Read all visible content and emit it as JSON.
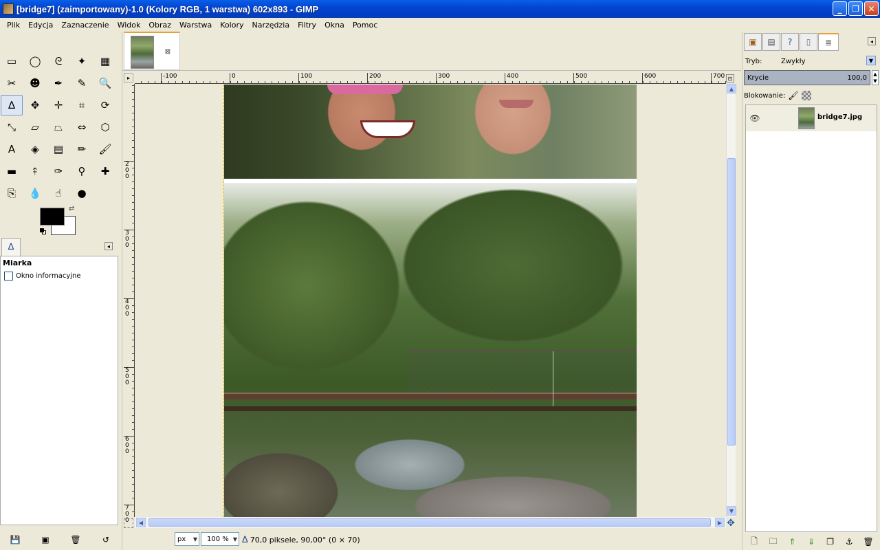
{
  "window": {
    "title": "[bridge7] (zaimportowany)-1.0 (Kolory RGB, 1 warstwa) 602x893 - GIMP",
    "minimize": "_",
    "maximize": "❐",
    "close": "✕"
  },
  "menu": {
    "items": [
      "Plik",
      "Edycja",
      "Zaznaczenie",
      "Widok",
      "Obraz",
      "Warstwa",
      "Kolory",
      "Narzędzia",
      "Filtry",
      "Okna",
      "Pomoc"
    ]
  },
  "toolbox": {
    "tools": [
      {
        "name": "rect-select-icon",
        "glyph": "▭"
      },
      {
        "name": "ellipse-select-icon",
        "glyph": "◯"
      },
      {
        "name": "free-select-icon",
        "glyph": "ᘓ"
      },
      {
        "name": "fuzzy-select-icon",
        "glyph": "✦"
      },
      {
        "name": "select-by-color-icon",
        "glyph": "▦"
      },
      {
        "name": "scissors-icon",
        "glyph": "✂"
      },
      {
        "name": "foreground-select-icon",
        "glyph": "☻"
      },
      {
        "name": "paths-icon",
        "glyph": "✒"
      },
      {
        "name": "color-picker-icon",
        "glyph": "✎"
      },
      {
        "name": "zoom-icon",
        "glyph": "🔍"
      },
      {
        "name": "measure-icon",
        "glyph": "∆"
      },
      {
        "name": "move-icon",
        "glyph": "✥"
      },
      {
        "name": "align-icon",
        "glyph": "✛"
      },
      {
        "name": "crop-icon",
        "glyph": "⌗"
      },
      {
        "name": "rotate-icon",
        "glyph": "⟳"
      },
      {
        "name": "scale-icon",
        "glyph": "⤡"
      },
      {
        "name": "shear-icon",
        "glyph": "▱"
      },
      {
        "name": "perspective-icon",
        "glyph": "⏢"
      },
      {
        "name": "flip-icon",
        "glyph": "⇔"
      },
      {
        "name": "cage-transform-icon",
        "glyph": "⬡"
      },
      {
        "name": "text-icon",
        "glyph": "A"
      },
      {
        "name": "bucket-fill-icon",
        "glyph": "◈"
      },
      {
        "name": "blend-icon",
        "glyph": "▤"
      },
      {
        "name": "pencil-icon",
        "glyph": "✏"
      },
      {
        "name": "paintbrush-icon",
        "glyph": "🖌"
      },
      {
        "name": "eraser-icon",
        "glyph": "▬"
      },
      {
        "name": "airbrush-icon",
        "glyph": "⤉"
      },
      {
        "name": "ink-icon",
        "glyph": "✑"
      },
      {
        "name": "clone-icon",
        "glyph": "⚲"
      },
      {
        "name": "heal-icon",
        "glyph": "✚"
      },
      {
        "name": "perspective-clone-icon",
        "glyph": "⎘"
      },
      {
        "name": "blur-sharpen-icon",
        "glyph": "💧"
      },
      {
        "name": "smudge-icon",
        "glyph": "☝"
      },
      {
        "name": "dodge-burn-icon",
        "glyph": "●"
      }
    ]
  },
  "tool_options": {
    "title": "Miarka",
    "info_window_label": "Okno informacyjne"
  },
  "ruler": {
    "h_labels": [
      "-100",
      "0",
      "100",
      "200",
      "300",
      "400",
      "500",
      "600",
      "700"
    ],
    "v_labels": [
      "200",
      "300",
      "400",
      "500",
      "600",
      "700"
    ]
  },
  "statusbar": {
    "unit": "px",
    "zoom": "100 %",
    "message": "70,0 piksele, 90,00° (0 × 70)"
  },
  "layers_dock": {
    "mode_label": "Tryb:",
    "mode_value": "Zwykły",
    "opacity_label": "Krycie",
    "opacity_value": "100,0",
    "lock_label": "Blokowanie:",
    "layers": [
      {
        "name": "bridge7.jpg",
        "visible": true
      }
    ]
  }
}
